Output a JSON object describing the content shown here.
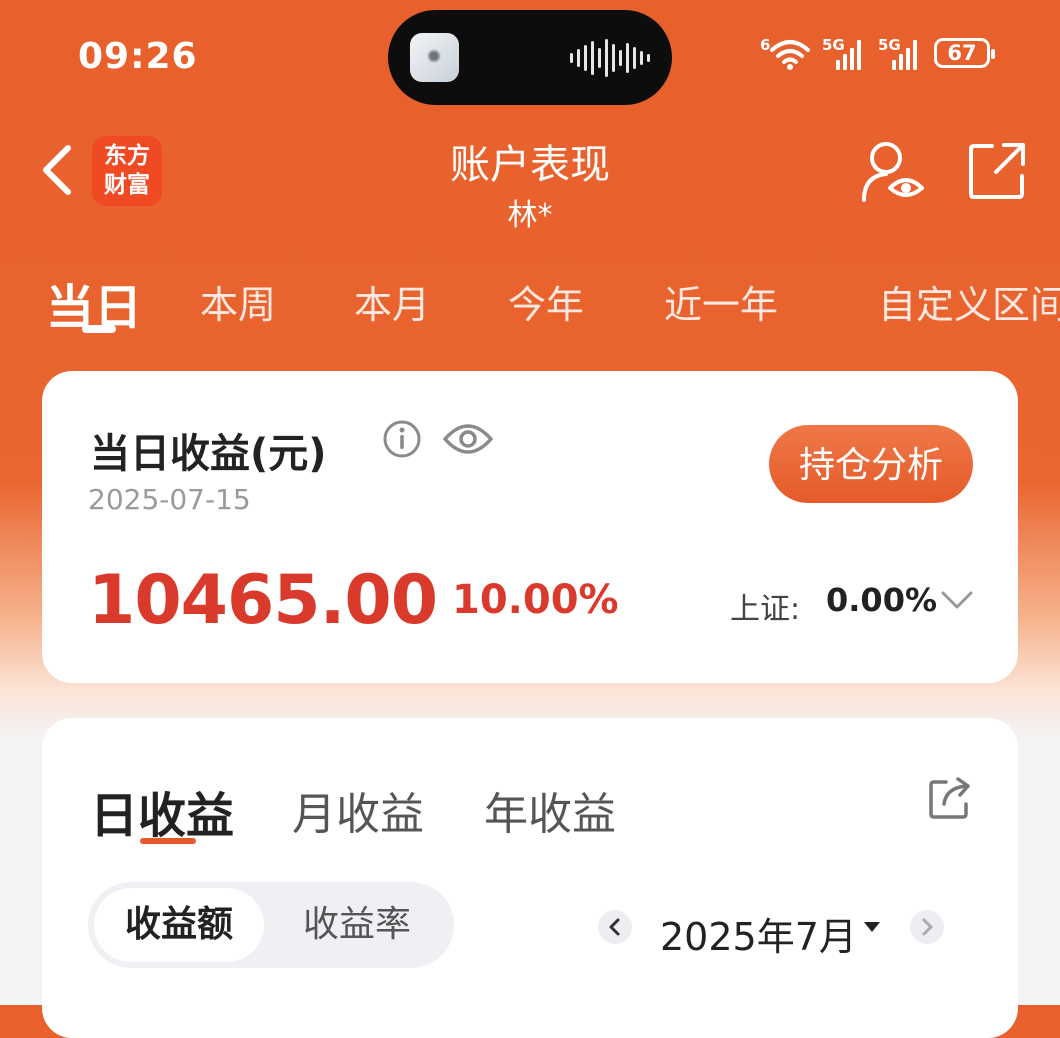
{
  "status_bar": {
    "time": "09:26",
    "net1": "6",
    "net2": "5G",
    "net3": "5G",
    "battery": "67"
  },
  "header": {
    "brand_line1": "东方",
    "brand_line2": "财富",
    "title": "账户表现",
    "subtitle": "林*"
  },
  "period_tabs": [
    "当日",
    "本周",
    "本月",
    "今年",
    "近一年",
    "自定义区间"
  ],
  "summary": {
    "title": "当日收益(元)",
    "date": "2025-07-15",
    "holding_button": "持仓分析",
    "amount": "10465.00",
    "rate": "10.00%",
    "index_label": "上证:",
    "index_value": "0.00%"
  },
  "earnings": {
    "tabs": [
      "日收益",
      "月收益",
      "年收益"
    ],
    "segments": [
      "收益额",
      "收益率"
    ],
    "month": "2025年7月"
  },
  "colors": {
    "brand_orange": "#e8602c",
    "profit_red": "#d93a2b",
    "logo_red": "#f04a24"
  },
  "icons": [
    "back-icon",
    "user-eye-icon",
    "export-icon",
    "info-icon",
    "eye-icon",
    "chevron-down-icon",
    "share-icon",
    "arrow-left-icon",
    "arrow-right-icon"
  ]
}
